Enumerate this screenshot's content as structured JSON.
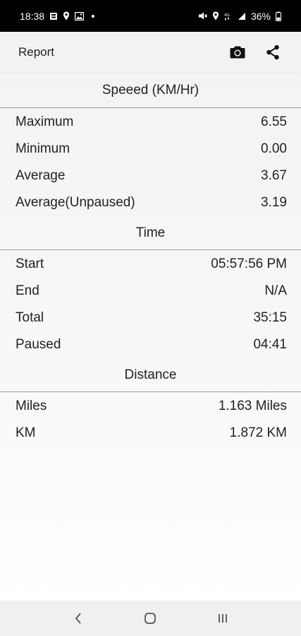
{
  "status_bar": {
    "time": "18:38",
    "battery": "36%",
    "icons_left": [
      "gallery-icon",
      "location-icon",
      "image-icon",
      "dot-icon"
    ],
    "icons_right": [
      "mute-icon",
      "location-icon",
      "data-icon",
      "signal-icon",
      "battery-icon"
    ]
  },
  "app_bar": {
    "title": "Report",
    "actions": [
      "camera-icon",
      "share-icon"
    ]
  },
  "sections": {
    "speed": {
      "title": "Speeed (KM/Hr)",
      "rows": [
        {
          "label": "Maximum",
          "value": "6.55"
        },
        {
          "label": "Minimum",
          "value": "0.00"
        },
        {
          "label": "Average",
          "value": "3.67"
        },
        {
          "label": "Average(Unpaused)",
          "value": "3.19"
        }
      ]
    },
    "time": {
      "title": "Time",
      "rows": [
        {
          "label": "Start",
          "value": "05:57:56 PM"
        },
        {
          "label": "End",
          "value": "N/A"
        },
        {
          "label": "Total",
          "value": "35:15"
        },
        {
          "label": "Paused",
          "value": "04:41"
        }
      ]
    },
    "distance": {
      "title": "Distance",
      "rows": [
        {
          "label": "Miles",
          "value": "1.163 Miles"
        },
        {
          "label": "KM",
          "value": "1.872 KM"
        }
      ]
    }
  },
  "nav_bar": {
    "buttons": [
      "back-icon",
      "home-icon",
      "recents-icon"
    ]
  }
}
